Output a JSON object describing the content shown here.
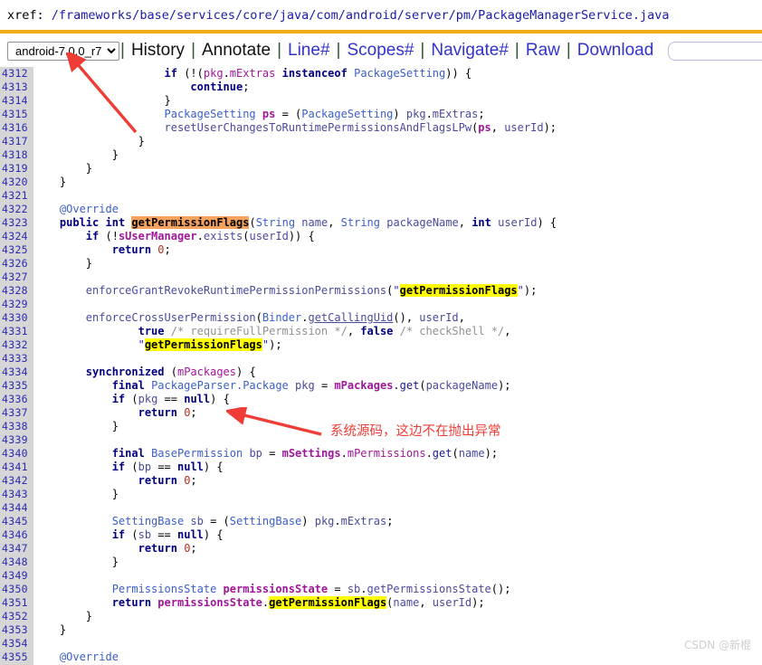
{
  "header": {
    "label": "xref:",
    "path": "/frameworks/base/services/core/java/com/android/server/pm/PackageManagerService.java",
    "bar_color": "#f0ad18"
  },
  "toolbar": {
    "project_selected": "android-7.0.0_r7",
    "project_options": [
      "android-7.0.0_r7"
    ],
    "separator": "|",
    "links": [
      {
        "label": "History",
        "style": "plain"
      },
      {
        "label": "Annotate",
        "style": "plain"
      },
      {
        "label": "Line#",
        "style": "link"
      },
      {
        "label": "Scopes#",
        "style": "link"
      },
      {
        "label": "Navigate#",
        "style": "link"
      },
      {
        "label": "Raw",
        "style": "link"
      },
      {
        "label": "Download",
        "style": "link"
      }
    ],
    "search": {
      "value": "",
      "placeholder": ""
    }
  },
  "code": {
    "first_line": 4312,
    "highlight_definition_color": "#f5a25d",
    "highlight_match_color": "#ffff00",
    "lines": [
      {
        "n": 4312,
        "html": "                    <span class='kw'>if</span> <span class='plainc'>(!(</span><span class='mem'>pkg</span><span class='plainc'>.</span><span class='mem'>mExtras</span> <span class='kw'>instanceof</span> <span class='typ'>PackageSetting</span><span class='plainc'>)) {</span>"
      },
      {
        "n": 4313,
        "html": "                        <span class='kw'>continue</span><span class='plainc'>;</span>"
      },
      {
        "n": 4314,
        "html": "                    <span class='plainc'>}</span>"
      },
      {
        "n": 4315,
        "html": "                    <span class='typ'>PackageSetting</span> <span class='var'>ps</span> <span class='plainc'>= (</span><span class='typ'>PackageSetting</span><span class='plainc'>) </span><span class='id'>pkg</span><span class='plainc'>.</span><span class='id'>mExtras</span><span class='plainc'>;</span>"
      },
      {
        "n": 4316,
        "html": "                    <span class='id'>resetUserChangesToRuntimePermissionsAndFlagsLPw</span><span class='plainc'>(</span><span class='var'>ps</span><span class='plainc'>, </span><span class='id'>userId</span><span class='plainc'>);</span>"
      },
      {
        "n": 4317,
        "html": "                <span class='plainc'>}</span>"
      },
      {
        "n": 4318,
        "html": "            <span class='plainc'>}</span>"
      },
      {
        "n": 4319,
        "html": "        <span class='plainc'>}</span>"
      },
      {
        "n": 4320,
        "html": "    <span class='plainc'>}</span>"
      },
      {
        "n": 4321,
        "html": ""
      },
      {
        "n": 4322,
        "html": "    <span class='ann'>@Override</span>"
      },
      {
        "n": 4323,
        "html": "    <span class='kw'>public</span> <span class='kw'>int</span> <span class='hl-orange'>getPermissionFlags</span><span class='plainc'>(</span><span class='typ'>String</span> <span class='id'>name</span><span class='plainc'>, </span><span class='typ'>String</span> <span class='id'>packageName</span><span class='plainc'>, </span><span class='kw'>int</span> <span class='id'>userId</span><span class='plainc'>) {</span>"
      },
      {
        "n": 4324,
        "html": "        <span class='kw'>if</span> <span class='plainc'>(!</span><span class='var'>sUserManager</span><span class='plainc'>.</span><span class='id'>exists</span><span class='plainc'>(</span><span class='id'>userId</span><span class='plainc'>)) {</span>"
      },
      {
        "n": 4325,
        "html": "            <span class='kw'>return</span> <span class='num'>0</span><span class='plainc'>;</span>"
      },
      {
        "n": 4326,
        "html": "        <span class='plainc'>}</span>"
      },
      {
        "n": 4327,
        "html": ""
      },
      {
        "n": 4328,
        "html": "        <span class='id'>enforceGrantRevokeRuntimePermissionPermissions</span><span class='plainc'>(</span><span class='str'>\"</span><span class='hl-yellow'>getPermissionFlags</span><span class='str'>\"</span><span class='plainc'>);</span>"
      },
      {
        "n": 4329,
        "html": ""
      },
      {
        "n": 4330,
        "html": "        <span class='id'>enforceCrossUserPermission</span><span class='plainc'>(</span><span class='typ'>Binder</span><span class='plainc'>.</span><span class='ulink'>getCallingUid</span><span class='plainc'>(), </span><span class='id'>userId</span><span class='plainc'>,</span>"
      },
      {
        "n": 4331,
        "html": "                <span class='kw'>true</span> <span class='cmt'>/* requireFullPermission */</span><span class='plainc'>, </span><span class='kw'>false</span> <span class='cmt'>/* checkShell */</span><span class='plainc'>,</span>"
      },
      {
        "n": 4332,
        "html": "                <span class='str'>\"</span><span class='hl-yellow'>getPermissionFlags</span><span class='str'>\"</span><span class='plainc'>);</span>"
      },
      {
        "n": 4333,
        "html": ""
      },
      {
        "n": 4334,
        "html": "        <span class='kw'>synchronized</span> <span class='plainc'>(</span><span class='mem'>mPackages</span><span class='plainc'>) {</span>"
      },
      {
        "n": 4335,
        "html": "            <span class='kw'>final</span> <span class='typ'>PackageParser.Package</span> <span class='id'>pkg</span> <span class='plainc'>= </span><span class='var'>mPackages</span><span class='plainc'>.</span><span class='func'>get</span><span class='plainc'>(</span><span class='id'>packageName</span><span class='plainc'>);</span>"
      },
      {
        "n": 4336,
        "html": "            <span class='kw'>if</span> <span class='plainc'>(</span><span class='id'>pkg</span> <span class='plainc'>== </span><span class='kw'>null</span><span class='plainc'>) {</span>"
      },
      {
        "n": 4337,
        "html": "                <span class='kw'>return</span> <span class='num'>0</span><span class='plainc'>;</span>"
      },
      {
        "n": 4338,
        "html": "            <span class='plainc'>}</span>"
      },
      {
        "n": 4339,
        "html": ""
      },
      {
        "n": 4340,
        "html": "            <span class='kw'>final</span> <span class='typ'>BasePermission</span> <span class='id'>bp</span> <span class='plainc'>= </span><span class='var'>mSettings</span><span class='plainc'>.</span><span class='mem'>mPermissions</span><span class='plainc'>.</span><span class='func'>get</span><span class='plainc'>(</span><span class='id'>name</span><span class='plainc'>);</span>"
      },
      {
        "n": 4341,
        "html": "            <span class='kw'>if</span> <span class='plainc'>(</span><span class='id'>bp</span> <span class='plainc'>== </span><span class='kw'>null</span><span class='plainc'>) {</span>"
      },
      {
        "n": 4342,
        "html": "                <span class='kw'>return</span> <span class='num'>0</span><span class='plainc'>;</span>"
      },
      {
        "n": 4343,
        "html": "            <span class='plainc'>}</span>"
      },
      {
        "n": 4344,
        "html": ""
      },
      {
        "n": 4345,
        "html": "            <span class='typ'>SettingBase</span> <span class='id'>sb</span> <span class='plainc'>= (</span><span class='typ'>SettingBase</span><span class='plainc'>) </span><span class='id'>pkg</span><span class='plainc'>.</span><span class='id'>mExtras</span><span class='plainc'>;</span>"
      },
      {
        "n": 4346,
        "html": "            <span class='kw'>if</span> <span class='plainc'>(</span><span class='id'>sb</span> <span class='plainc'>== </span><span class='kw'>null</span><span class='plainc'>) {</span>"
      },
      {
        "n": 4347,
        "html": "                <span class='kw'>return</span> <span class='num'>0</span><span class='plainc'>;</span>"
      },
      {
        "n": 4348,
        "html": "            <span class='plainc'>}</span>"
      },
      {
        "n": 4349,
        "html": ""
      },
      {
        "n": 4350,
        "html": "            <span class='typ'>PermissionsState</span> <span class='var'>permissionsState</span> <span class='plainc'>= </span><span class='id'>sb</span><span class='plainc'>.</span><span class='id'>getPermissionsState</span><span class='plainc'>();</span>"
      },
      {
        "n": 4351,
        "html": "            <span class='kw'>return</span> <span class='var'>permissionsState</span><span class='plainc'>.</span><span class='hl-yellow'>getPermissionFlags</span><span class='plainc'>(</span><span class='id'>name</span><span class='plainc'>, </span><span class='id'>userId</span><span class='plainc'>);</span>"
      },
      {
        "n": 4352,
        "html": "        <span class='plainc'>}</span>"
      },
      {
        "n": 4353,
        "html": "    <span class='plainc'>}</span>"
      },
      {
        "n": 4354,
        "html": ""
      },
      {
        "n": 4355,
        "html": "    <span class='ann'>@Override</span>"
      }
    ]
  },
  "annotations": {
    "arrow_color": "#f03c36",
    "note_text": "系统源码，这边不在抛出异常"
  },
  "watermark": "CSDN @新棍"
}
